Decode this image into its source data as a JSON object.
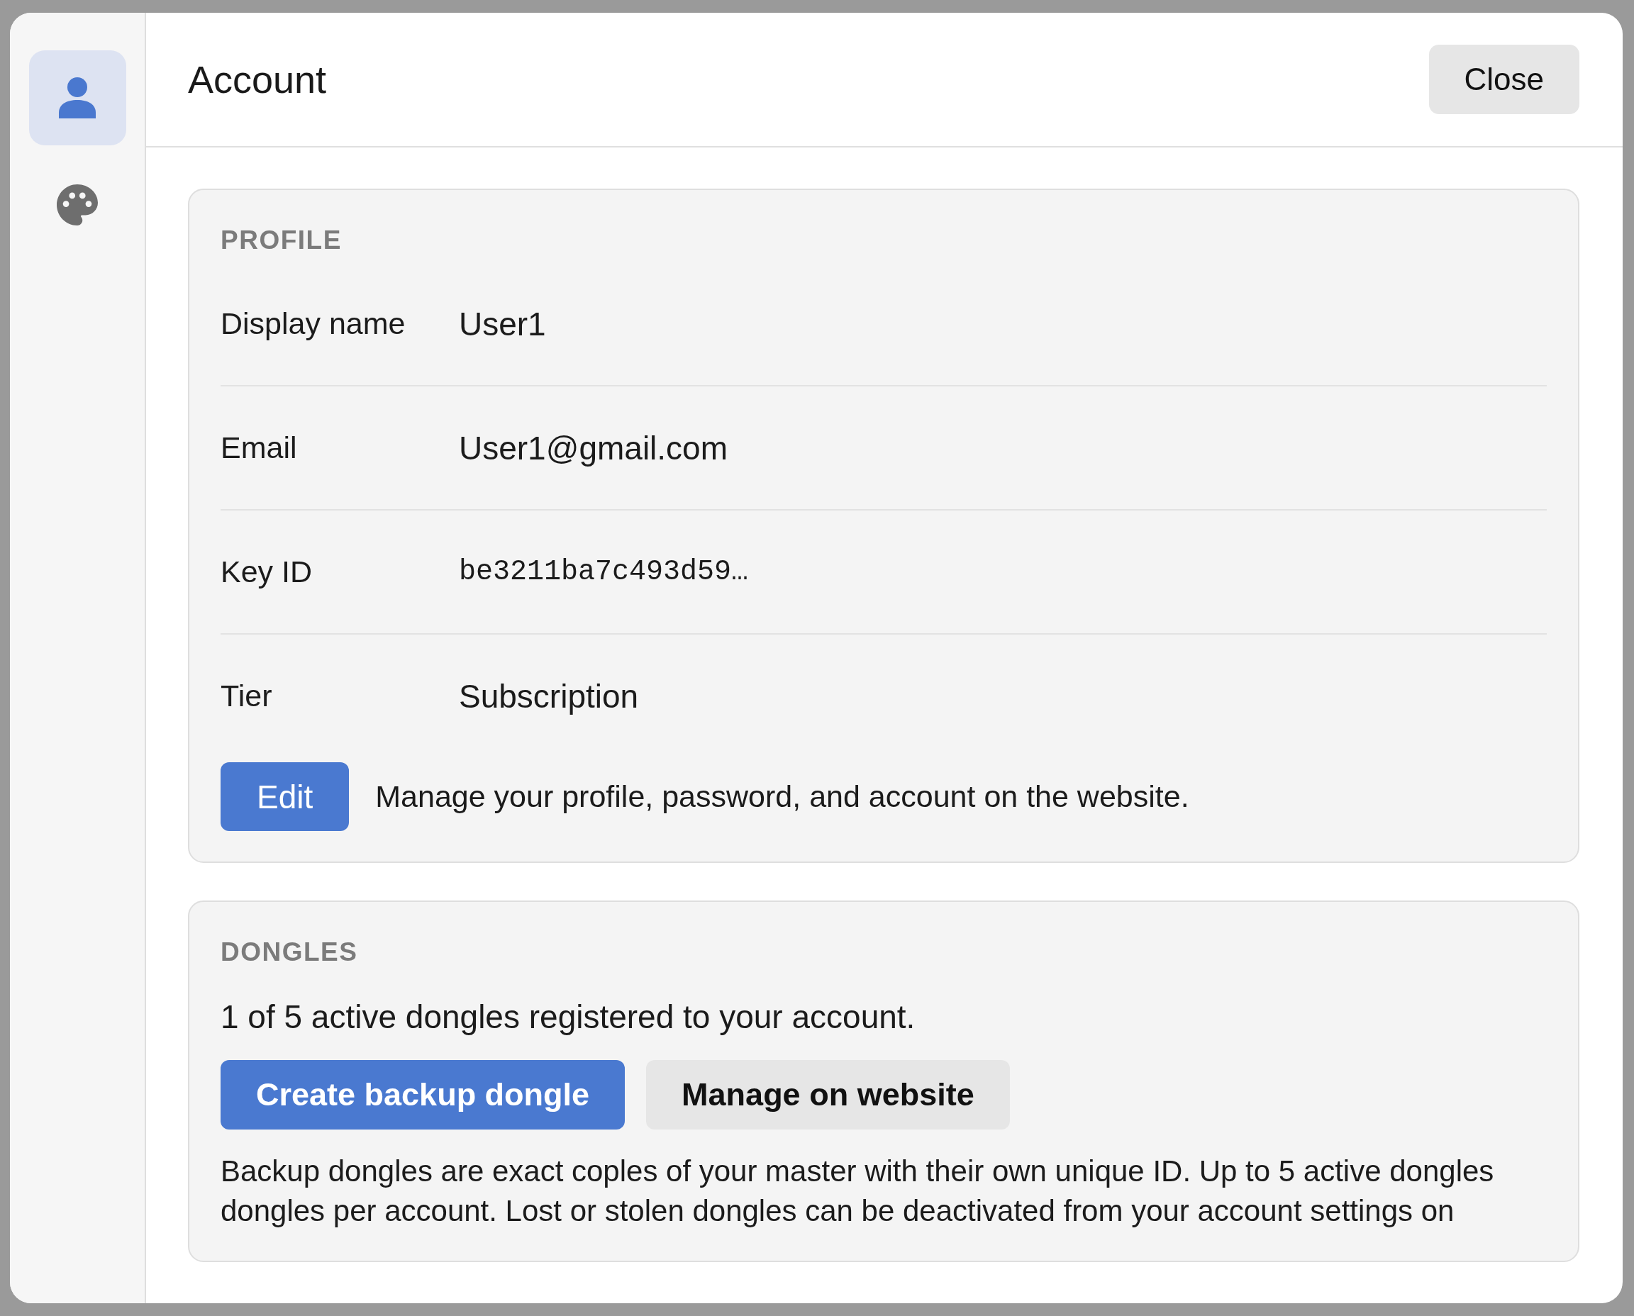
{
  "window": {
    "title": "Account",
    "close_button": "Close"
  },
  "sidebar": {
    "items": [
      {
        "kind": "person",
        "selected": true
      },
      {
        "kind": "palette",
        "selected": false
      }
    ]
  },
  "profile": {
    "heading": "PROFILE",
    "fields": [
      {
        "label": "Display name",
        "value": "User1",
        "kind": "text"
      },
      {
        "label": "Email",
        "value": "User1@gmail.com",
        "kind": "text"
      },
      {
        "label": "Key ID",
        "value": "be3211ba7c493d59…",
        "kind": "code"
      },
      {
        "label": "Tier",
        "value": "Subscription",
        "kind": "text"
      }
    ],
    "edit_button": "Edit",
    "edit_note": "Manage your profile, password, and account on the website."
  },
  "dongles": {
    "heading": "DONGLES",
    "summary": "1 of 5 active dongles registered to your account.",
    "buttons": [
      {
        "label": "Create backup dongle",
        "kind": "primary"
      },
      {
        "label": "Manage on website",
        "kind": "secondary"
      }
    ],
    "note_lines": [
      "Backup dongles are exact coples of your master with their own unique ID. Up to 5 active dongles",
      "dongles per account. Lost or stolen dongles can be deactivated from your account settings on"
    ]
  }
}
